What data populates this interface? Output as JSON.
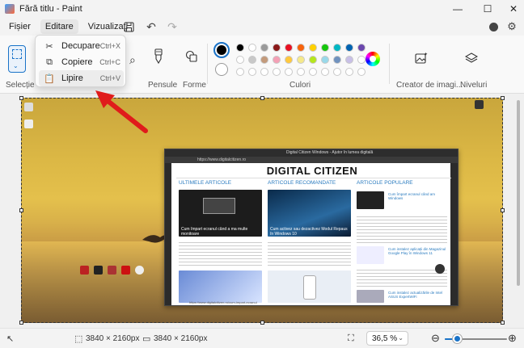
{
  "window": {
    "title": "Fără titlu - Paint",
    "minimize_icon": "minimize-icon",
    "maximize_icon": "maximize-icon",
    "close_icon": "close-icon"
  },
  "menu": {
    "items": [
      "Fișier",
      "Editare",
      "Vizualizați"
    ],
    "active": "Editare",
    "icons": [
      "save-icon",
      "undo-icon",
      "redo-icon",
      "account-icon",
      "settings-icon"
    ]
  },
  "edit_menu": {
    "items": [
      {
        "label": "Decupare",
        "shortcut": "Ctrl+X",
        "icon": "cut-icon"
      },
      {
        "label": "Copiere",
        "shortcut": "Ctrl+C",
        "icon": "copy-icon"
      },
      {
        "label": "Lipire",
        "shortcut": "Ctrl+V",
        "icon": "paste-icon"
      }
    ],
    "highlighted": "Lipire"
  },
  "ribbon": {
    "groups": {
      "selection": "Selecție",
      "brushes": "Pensule",
      "shapes": "Forme",
      "colors": "Culori",
      "image_creator": "Creator de imagi...",
      "layers": "Niveluri"
    },
    "primary_color": "#000000",
    "secondary_color": "#ffffff",
    "palette_row1": [
      "#000000",
      "#ffffff",
      "#9a9a9a",
      "#8b1a1a",
      "#e81123",
      "#f7630c",
      "#ffd100",
      "#16c60c",
      "#00b7c3",
      "#0063b1",
      "#6b47ad"
    ],
    "palette_row2": [
      "#ffffff",
      "#c8c8c8",
      "#c39a7b",
      "#f4a0b5",
      "#ffc83d",
      "#f5e98a",
      "#b5e61d",
      "#99d9ea",
      "#7092be",
      "#c8bfe7",
      "#ffffff"
    ],
    "palette_row3": [
      "#ffffff",
      "#ffffff",
      "#ffffff",
      "#ffffff",
      "#ffffff",
      "#ffffff",
      "#ffffff",
      "#ffffff",
      "#ffffff",
      "#ffffff",
      "#ffffff"
    ]
  },
  "screenshot_browser": {
    "tab_title": "Digital Citizen Windows - Ajutor în lumea digitală",
    "url": "https://www.digitalcitizen.ro",
    "logo": "DIGITAL CITIZEN",
    "columns": [
      "ULTIMELE ARTICOLE",
      "ARTICOLE RECOMANDATE",
      "ARTICOLE POPULARE"
    ],
    "article1_title": "Cum împart ecranul când a ma multe monitoare",
    "article2_title": "Cum activez sau dezactivez Modul Repaus în Windows 10",
    "popular": [
      "Cum împart ecranul când am Windows",
      "Cum instalez aplicații din Magazinul Google Play în Windows 11",
      "Cum instalez actualizările de Intel ASUS ExpertWiFi"
    ],
    "status_url": "https://www.digitalcitizen.ro/cum-impart-ecranul"
  },
  "status": {
    "pointer_icon": "pointer-icon",
    "selection_size": "3840 × 2160px",
    "image_size": "3840 × 2160px",
    "zoom": "36,5 %",
    "zoom_level": 0.365
  }
}
